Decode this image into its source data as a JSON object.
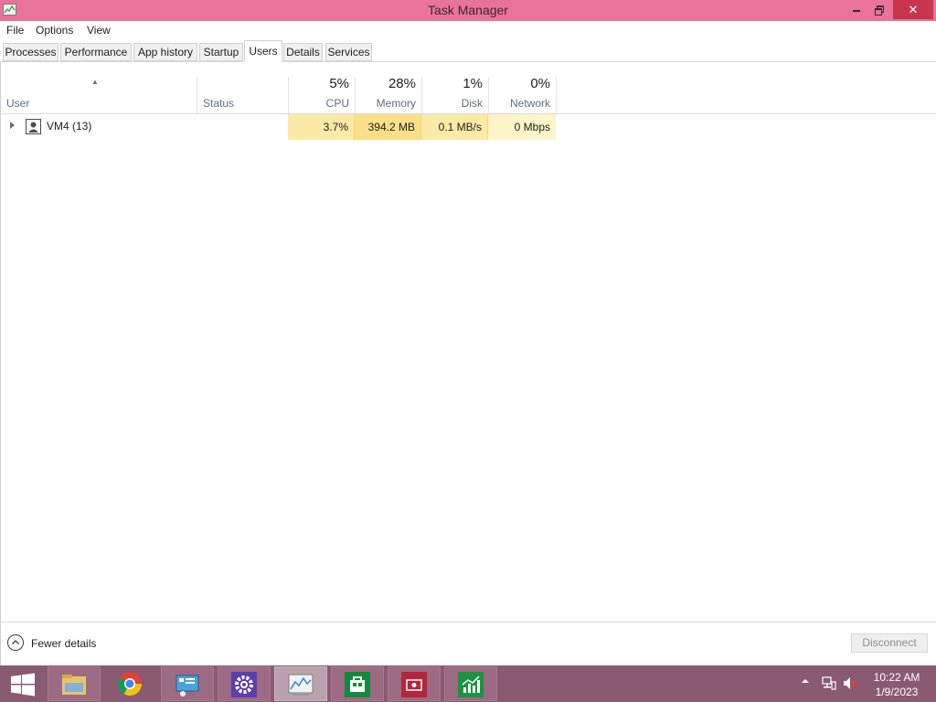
{
  "window": {
    "title": "Task Manager",
    "close_glyph": "✕"
  },
  "menu": [
    "File",
    "Options",
    "View"
  ],
  "tabs": [
    {
      "label": "Processes"
    },
    {
      "label": "Performance"
    },
    {
      "label": "App history"
    },
    {
      "label": "Startup"
    },
    {
      "label": "Users",
      "active": true
    },
    {
      "label": "Details"
    },
    {
      "label": "Services"
    }
  ],
  "columns": {
    "user": {
      "name": "User"
    },
    "status": {
      "name": "Status"
    },
    "cpu": {
      "pct": "5%",
      "name": "CPU"
    },
    "memory": {
      "pct": "28%",
      "name": "Memory"
    },
    "disk": {
      "pct": "1%",
      "name": "Disk"
    },
    "network": {
      "pct": "0%",
      "name": "Network"
    }
  },
  "rows": [
    {
      "user": "VM4 (13)",
      "status": "",
      "cpu": "3.7%",
      "memory": "394.2 MB",
      "disk": "0.1 MB/s",
      "network": "0 Mbps"
    }
  ],
  "footer": {
    "fewer_details": "Fewer details",
    "disconnect": "Disconnect"
  },
  "taskbar": {
    "items": [
      "start-icon",
      "file-explorer-icon",
      "chrome-icon",
      "server-manager-icon",
      "settings-icon",
      "task-manager-icon",
      "store-icon",
      "app-icon",
      "finance-icon"
    ],
    "clock": {
      "time": "10:22 AM",
      "date": "1/9/2023"
    }
  },
  "colors": {
    "titlebar": "#e9739a",
    "close_button": "#c7354f",
    "taskbar": "#8a5a73",
    "heat_low": "#fbeaa6",
    "heat_mid": "#f9df86"
  }
}
